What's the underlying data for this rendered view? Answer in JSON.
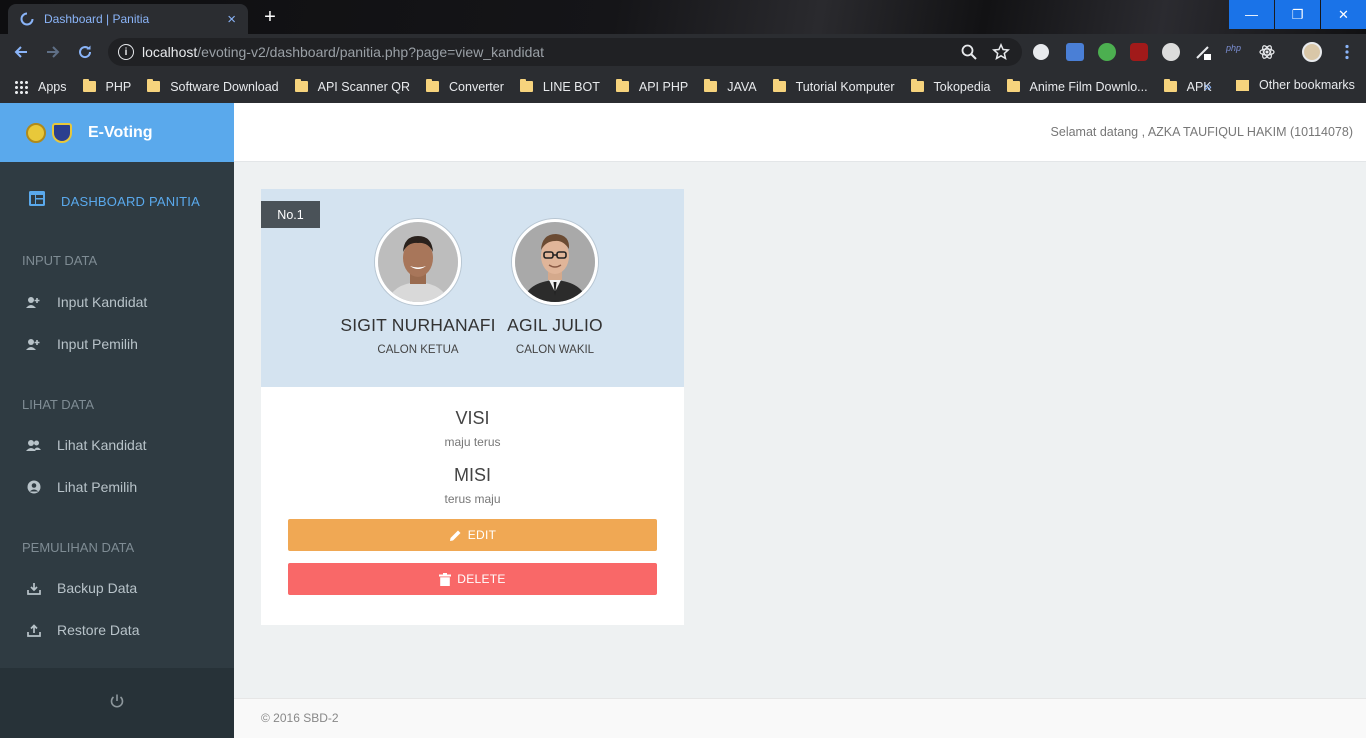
{
  "browser": {
    "tab_title": "Dashboard | Panitia",
    "tab_close": "×",
    "new_tab": "+",
    "url_host": "localhost",
    "url_path": "/evoting-v2/dashboard/panitia.php?page=view_kandidat",
    "window_minimize": "—",
    "window_restore": "❐",
    "window_close": "✕",
    "bookmarks": [
      "Apps",
      "PHP",
      "Software Download",
      "API Scanner QR",
      "Converter",
      "LINE BOT",
      "API PHP",
      "JAVA",
      "Tutorial Komputer",
      "Tokopedia",
      "Anime Film Downlo...",
      "APK"
    ],
    "bookmarks_more": "»",
    "other_bookmarks": "Other bookmarks"
  },
  "brand": {
    "name": "E-Voting"
  },
  "sidebar": {
    "dashboard": "DASHBOARD PANITIA",
    "section_input": "INPUT DATA",
    "input_kandidat": "Input Kandidat",
    "input_pemilih": "Input Pemilih",
    "section_lihat": "LIHAT DATA",
    "lihat_kandidat": "Lihat Kandidat",
    "lihat_pemilih": "Lihat Pemilih",
    "section_pemulihan": "PEMULIHAN DATA",
    "backup": "Backup Data",
    "restore": "Restore Data"
  },
  "header": {
    "welcome": "Selamat datang , AZKA TAUFIQUL HAKIM (10114078)"
  },
  "candidate": {
    "number": "No.1",
    "ketua_name": "SIGIT NURHANAFI",
    "ketua_role": "CALON KETUA",
    "wakil_name": "AGIL JULIO",
    "wakil_role": "CALON WAKIL",
    "visi_title": "VISI",
    "visi_text": "maju terus",
    "misi_title": "MISI",
    "misi_text": "terus maju",
    "edit_label": "EDIT",
    "delete_label": "DELETE"
  },
  "footer": {
    "copyright": "© 2016 SBD-2"
  },
  "colors": {
    "brand_blue": "#5aa9ec",
    "sidebar_bg": "#2f3b42",
    "edit_orange": "#f0a854",
    "delete_red": "#f96868",
    "card_top": "#d4e3f0"
  }
}
